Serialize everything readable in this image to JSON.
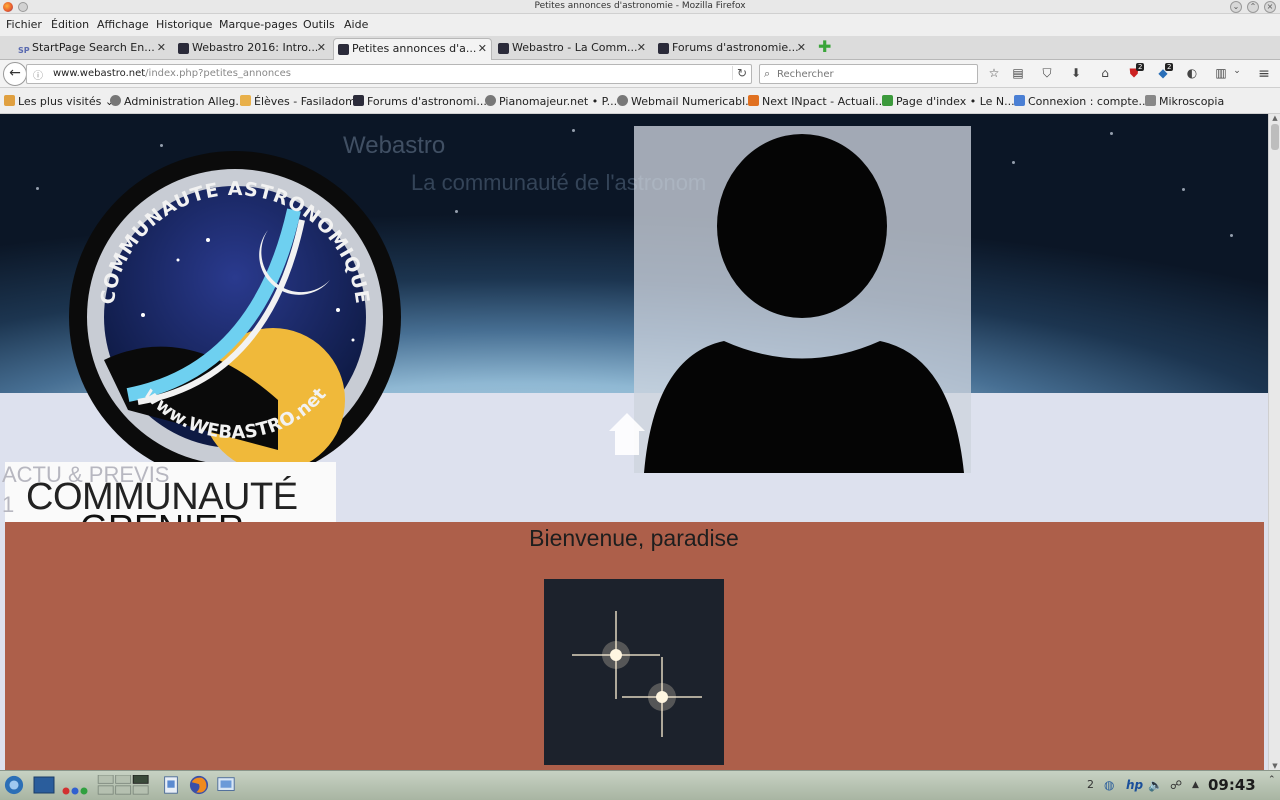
{
  "window": {
    "title": "Petites annonces d'astronomie - Mozilla Firefox"
  },
  "menu": [
    "Fichier",
    "Édition",
    "Affichage",
    "Historique",
    "Marque-pages",
    "Outils",
    "Aide"
  ],
  "tabs": [
    {
      "label": "StartPage Search En...",
      "active": false
    },
    {
      "label": "Webastro 2016: Intro...",
      "active": false
    },
    {
      "label": "Petites annonces d'a...",
      "active": true
    },
    {
      "label": "Webastro - La Comm...",
      "active": false
    },
    {
      "label": "Forums d'astronomie...",
      "active": false
    }
  ],
  "nav": {
    "url_host": "www.webastro.net",
    "url_path": "/index.php?petites_annonces",
    "search_placeholder": "Rechercher",
    "badges": [
      "2",
      "2"
    ]
  },
  "bookmarks": [
    "Les plus visités",
    "Administration Alleg...",
    "Élèves - Fasiladom",
    "Forums d'astronomi...",
    "Pianomajeur.net • P...",
    "Webmail Numericabl...",
    "Next INpact - Actuali...",
    "Page d'index • Le N...",
    "Connexion : compte...",
    "Mikroscopia"
  ],
  "page": {
    "site_name": "Webastro",
    "tagline": "La communauté de l'astronom",
    "logo_text_top": "COMMUNAUTE ASTRONOMIQUE",
    "logo_text_bottom": "www.WEBASTRO.net",
    "menu_behind_1": "ACTU & PREVIS",
    "menu_behind_2": "1",
    "menu_title_1": "COMMUNAUTÉ",
    "menu_title_2": "GRENIER",
    "welcome": "Bienvenue, paradise"
  },
  "taskbar": {
    "clock": "09:43",
    "desktop_number": "2"
  },
  "colors": {
    "panel": "#ad5f4a",
    "lilac": "#dde1ee",
    "strip": "#d4aaa0"
  }
}
